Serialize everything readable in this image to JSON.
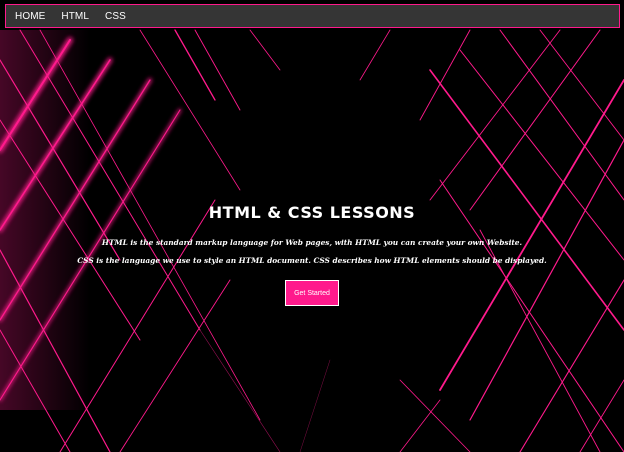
{
  "nav": {
    "items": [
      {
        "label": "HOME"
      },
      {
        "label": "HTML"
      },
      {
        "label": "CSS"
      }
    ]
  },
  "hero": {
    "title": "HTML & CSS LESSONS",
    "line1": "HTML is the standard markup language for Web pages, with HTML you can create your own Website.",
    "line2": "CSS is the language we use to style an HTML document. CSS describes how HTML elements should be displayed.",
    "button_label": "Get Started"
  },
  "colors": {
    "accent": "#ff1a8c",
    "navbar_bg": "#353535",
    "background": "#000000",
    "text": "#ffffff"
  }
}
